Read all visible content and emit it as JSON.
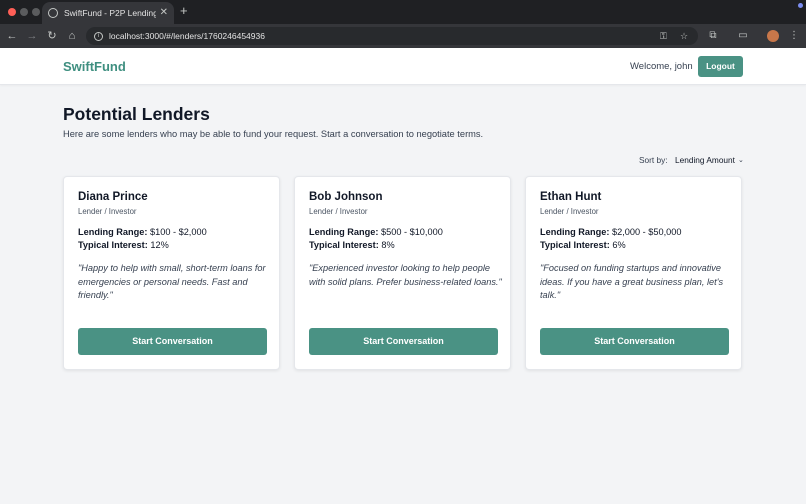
{
  "browser": {
    "tab_title": "SwiftFund - P2P Lending",
    "url": "localhost:3000/#/lenders/1760246454936"
  },
  "app": {
    "brand": "SwiftFund",
    "welcome": "Welcome, john",
    "logout_label": "Logout"
  },
  "page": {
    "title": "Potential Lenders",
    "subtitle": "Here are some lenders who may be able to fund your request. Start a conversation to negotiate terms.",
    "sort_label": "Sort by:",
    "sort_value": "Lending Amount"
  },
  "labels": {
    "range": "Lending Range:",
    "interest": "Typical Interest:"
  },
  "lenders": [
    {
      "name": "Diana Prince",
      "role": "Lender / Investor",
      "range": "$100 - $2,000",
      "interest": "12%",
      "quote": "\"Happy to help with small, short-term loans for emergencies or personal needs. Fast and friendly.\"",
      "button": "Start Conversation"
    },
    {
      "name": "Bob Johnson",
      "role": "Lender / Investor",
      "range": "$500 - $10,000",
      "interest": "8%",
      "quote": "\"Experienced investor looking to help people with solid plans. Prefer business-related loans.\"",
      "button": "Start Conversation"
    },
    {
      "name": "Ethan Hunt",
      "role": "Lender / Investor",
      "range": "$2,000 - $50,000",
      "interest": "6%",
      "quote": "\"Focused on funding startups and innovative ideas. If you have a great business plan, let's talk.\"",
      "button": "Start Conversation"
    }
  ],
  "colors": {
    "brand": "#3f8f80",
    "button": "#4a9284",
    "background": "#f3f4f6"
  }
}
